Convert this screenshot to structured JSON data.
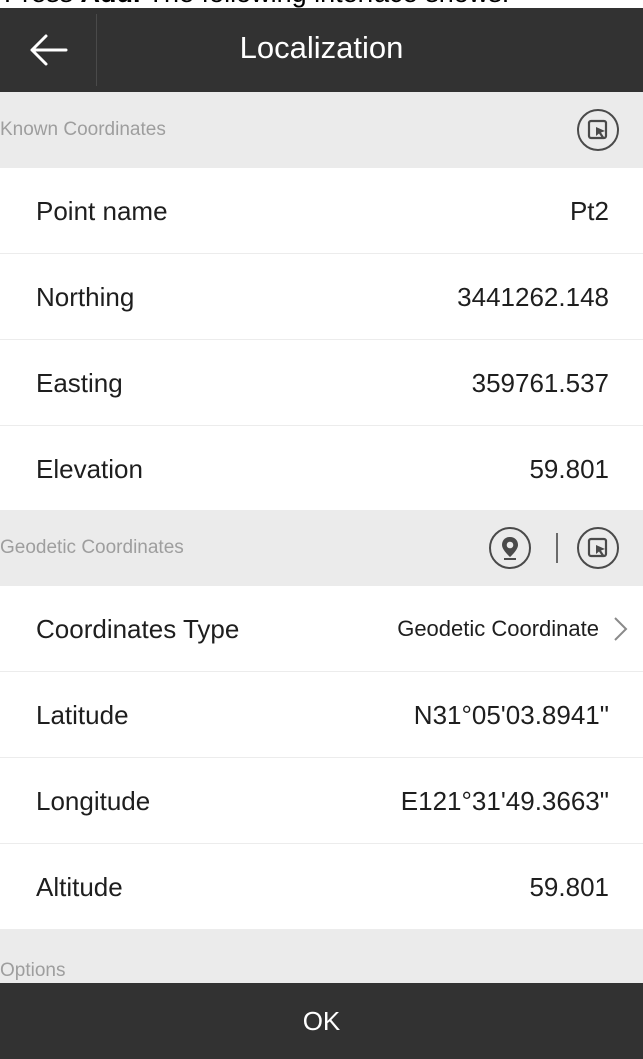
{
  "caption": {
    "bold": "Add.",
    "rest": " The following interface shows:",
    "prefix": "Press "
  },
  "header": {
    "title": "Localization",
    "back_icon": "arrow-left-icon"
  },
  "known": {
    "section_label": "Known Coordinates",
    "rows": [
      {
        "label": "Point name",
        "value": "Pt2"
      },
      {
        "label": "Northing",
        "value": "3441262.148"
      },
      {
        "label": "Easting",
        "value": "359761.537"
      },
      {
        "label": "Elevation",
        "value": "59.801"
      }
    ]
  },
  "geodetic": {
    "section_label": "Geodetic Coordinates",
    "coord_type": {
      "label": "Coordinates Type",
      "value": "Geodetic Coordinate"
    },
    "rows": [
      {
        "label": "Latitude",
        "value": "N31°05'03.8941\""
      },
      {
        "label": "Longitude",
        "value": "E121°31'49.3663\""
      },
      {
        "label": "Altitude",
        "value": "59.801"
      }
    ]
  },
  "options": {
    "section_label": "Options"
  },
  "footer": {
    "ok_label": "OK"
  },
  "colors": {
    "header_bg": "#323232",
    "section_bg": "#ebebeb",
    "section_text": "#9e9e9e"
  }
}
